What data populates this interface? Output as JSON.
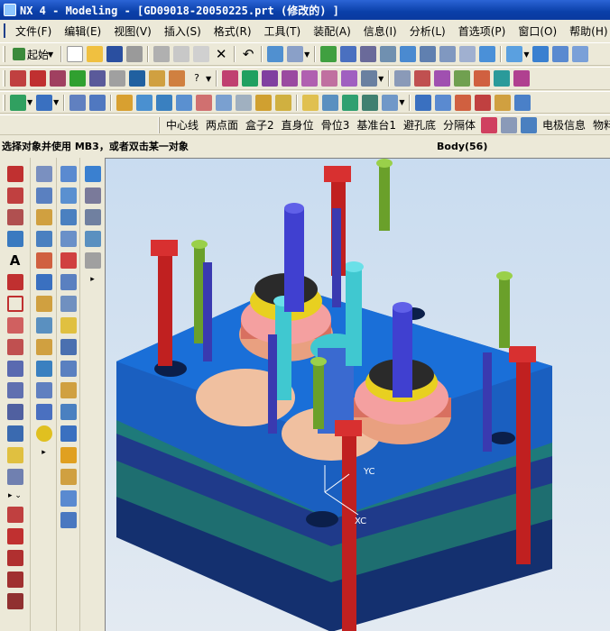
{
  "title": "NX 4 - Modeling - [GD09018-20050225.prt (修改的) ]",
  "menu": [
    "文件(F)",
    "编辑(E)",
    "视图(V)",
    "插入(S)",
    "格式(R)",
    "工具(T)",
    "装配(A)",
    "信息(I)",
    "分析(L)",
    "首选项(P)",
    "窗口(O)",
    "帮助(H)"
  ],
  "start_label": "起始",
  "custom_buttons": [
    "中心线",
    "两点面",
    "盒子2",
    "直身位",
    "骨位3",
    "基准台1",
    "避孔底",
    "分隔体",
    "电极信息",
    "物料单"
  ],
  "cue_line": "选择对象并使用 MB3，或者双击某一对象",
  "status_line": "Body(56)",
  "axis_labels": {
    "yc": "YC",
    "xc": "XC"
  },
  "colors": {
    "plate_blue": "#1a5fc0",
    "plate_dark": "#1f3a8a",
    "plate_teal": "#1e7a7a",
    "red_post": "#c02020",
    "green_bolt": "#6aa02a",
    "gear_pink": "#f4a0a0",
    "gear_dark": "#2a2a2a",
    "core_blue": "#4040d0",
    "cyan": "#40c8d0",
    "yellow": "#e8d020"
  }
}
